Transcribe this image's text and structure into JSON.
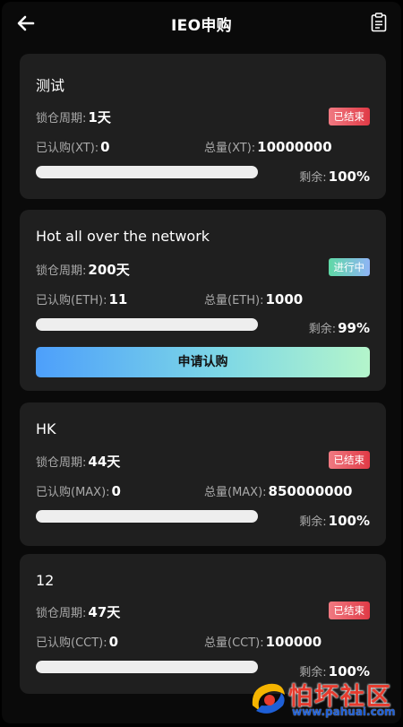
{
  "header": {
    "title": "IEO申购"
  },
  "icons": {
    "back": "arrow-left-icon",
    "records": "clipboard-icon"
  },
  "colors": {
    "card_bg": "#1f1f1f",
    "ended_badge": "#e03a46",
    "live_badge": "#5fd9a6",
    "apply_gradient_start": "#4d9ffb",
    "apply_gradient_end": "#b4f5cb"
  },
  "projects": [
    {
      "name": "测试",
      "lock_label": "锁仓周期:",
      "lock_value": "1天",
      "status": "已结束",
      "subscribed_label": "已认购(XT):",
      "subscribed_value": "0",
      "total_label": "总量(XT):",
      "total_value": "10000000",
      "remaining_label": "剩余:",
      "remaining_value": "100%",
      "progress": 0
    },
    {
      "name": "Hot all over the network",
      "lock_label": "锁仓周期:",
      "lock_value": "200天",
      "status": "进行中",
      "subscribed_label": "已认购(ETH):",
      "subscribed_value": "11",
      "total_label": "总量(ETH):",
      "total_value": "1000",
      "remaining_label": "剩余:",
      "remaining_value": "99%",
      "progress": 0,
      "apply_label": "申请认购"
    },
    {
      "name": "HK",
      "lock_label": "锁仓周期:",
      "lock_value": "44天",
      "status": "已结束",
      "subscribed_label": "已认购(MAX):",
      "subscribed_value": "0",
      "total_label": "总量(MAX):",
      "total_value": "850000000",
      "remaining_label": "剩余:",
      "remaining_value": "100%",
      "progress": 0
    },
    {
      "name": "12",
      "lock_label": "锁仓周期:",
      "lock_value": "47天",
      "status": "已结束",
      "subscribed_label": "已认购(CCT):",
      "subscribed_value": "0",
      "total_label": "总量(CCT):",
      "total_value": "100000",
      "remaining_label": "剩余:",
      "remaining_value": "100%",
      "progress": 0
    }
  ],
  "watermark": {
    "text": "怕坏社区",
    "url": "www.pahuai.com"
  }
}
